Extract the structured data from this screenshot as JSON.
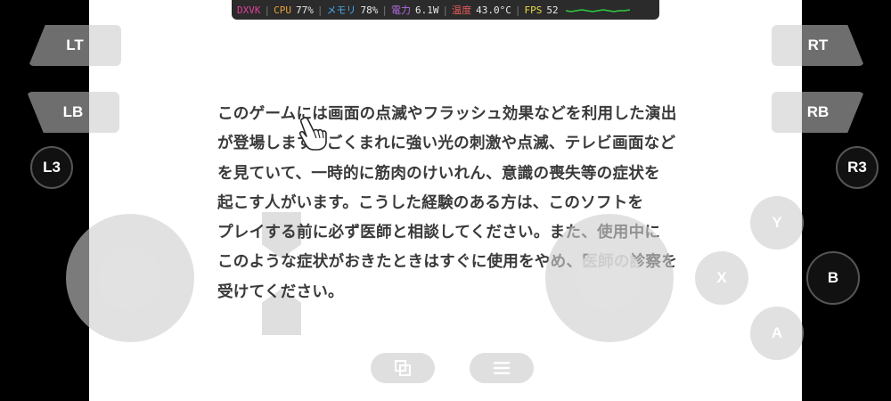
{
  "hud": {
    "api": "DXVK",
    "cpu_label": "CPU",
    "cpu_value": "77%",
    "mem_label": "メモリ",
    "mem_value": "78%",
    "power_label": "電力",
    "power_value": "6.1W",
    "temp_label": "温度",
    "temp_value": "43.0°C",
    "fps_label": "FPS",
    "fps_value": "52",
    "colors": {
      "api": "#e0409a",
      "cpu": "#e8a23a",
      "mem": "#4aa8e8",
      "power": "#b06be0",
      "temp": "#e85a5a",
      "fps": "#e8d84a",
      "graph": "#2ecc40"
    }
  },
  "warning_lines": [
    "このゲームには画面の点滅やフラッシュ効果などを利用した演出",
    "が登場します。ごくまれに強い光の刺激や点滅、テレビ画面など",
    "を見ていて、一時的に筋肉のけいれん、意識の喪失等の症状を",
    "起こす人がいます。こうした経験のある方は、このソフトを",
    "プレイする前に必ず医師と相談してください。また、使用中に",
    "このような症状がおきたときはすぐに使用をやめ、医師の診察を",
    "受けてください。"
  ],
  "controls": {
    "lt": "LT",
    "lb": "LB",
    "rt": "RT",
    "rb": "RB",
    "l3": "L3",
    "r3": "R3",
    "y": "Y",
    "x": "X",
    "b": "B",
    "a": "A"
  },
  "icons": {
    "window_toggle": "window-switch-icon",
    "menu": "hamburger-menu-icon",
    "cursor": "hand-pointer-icon"
  }
}
